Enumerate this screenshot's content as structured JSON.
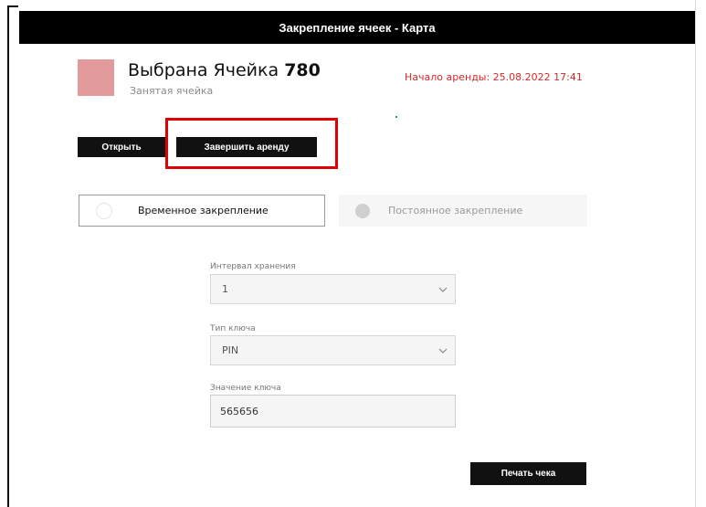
{
  "window": {
    "title": "Закрепление ячеек - Карта"
  },
  "cell": {
    "title_prefix": "Выбрана Ячейка",
    "number": "780",
    "status": "Занятая ячейка",
    "color": "#e29a9c"
  },
  "rent": {
    "start_text": "Начало аренды: 25.08.2022 17:41"
  },
  "actions": {
    "open_label": "Открыть",
    "finish_label": "Завершить аренду"
  },
  "pinning": {
    "temporary_label": "Временное закрепление",
    "permanent_label": "Постоянное закрепление"
  },
  "form": {
    "interval": {
      "label": "Интервал хранения",
      "value": "1"
    },
    "key_type": {
      "label": "Тип ключа",
      "value": "PIN"
    },
    "key_value": {
      "label": "Значение ключа",
      "value": "565656"
    }
  },
  "footer": {
    "print_label": "Печать чека"
  },
  "colors": {
    "titlebar": "#000000",
    "accent_red": "#d12b2b",
    "highlight": "#e00000"
  }
}
